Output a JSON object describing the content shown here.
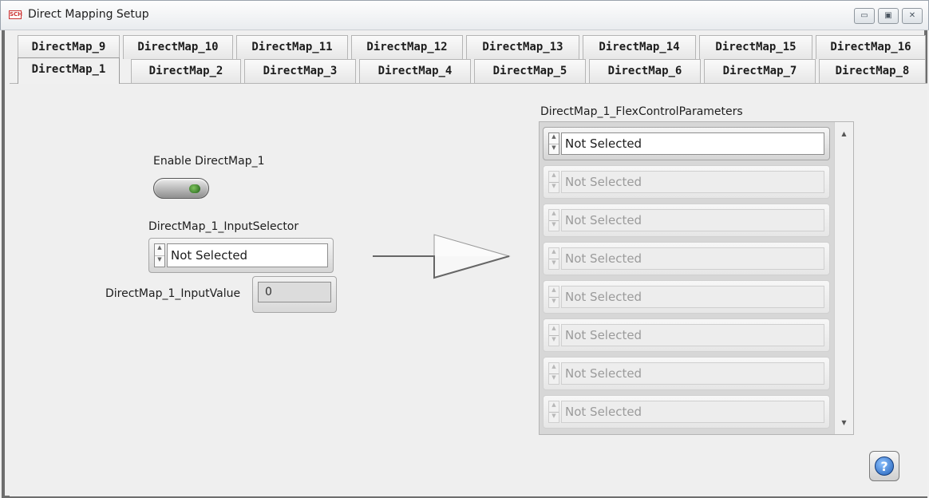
{
  "window": {
    "title": "Direct Mapping Setup",
    "icon_text": "SCH",
    "minimize_icon": "▭",
    "maximize_icon": "▣",
    "close_icon": "✕"
  },
  "tabs": {
    "row1": [
      "DirectMap_9",
      "DirectMap_10",
      "DirectMap_11",
      "DirectMap_12",
      "DirectMap_13",
      "DirectMap_14",
      "DirectMap_15",
      "DirectMap_16"
    ],
    "row2": [
      "DirectMap_1",
      "DirectMap_2",
      "DirectMap_3",
      "DirectMap_4",
      "DirectMap_5",
      "DirectMap_6",
      "DirectMap_7",
      "DirectMap_8"
    ],
    "active": "DirectMap_1"
  },
  "enable": {
    "label": "Enable DirectMap_1",
    "state": "on"
  },
  "input_selector": {
    "label": "DirectMap_1_InputSelector",
    "value": "Not Selected"
  },
  "input_value": {
    "label": "DirectMap_1_InputValue",
    "value": "0"
  },
  "flex": {
    "label": "DirectMap_1_FlexControlParameters",
    "items": [
      "Not Selected",
      "Not Selected",
      "Not Selected",
      "Not Selected",
      "Not Selected",
      "Not Selected",
      "Not Selected",
      "Not Selected"
    ],
    "enabled_count": 1
  },
  "help": {
    "icon": "?"
  },
  "colors": {
    "led_green": "#2e8b2e",
    "help_blue": "#1f5eb8",
    "frame_gray": "#6e6e6e"
  }
}
